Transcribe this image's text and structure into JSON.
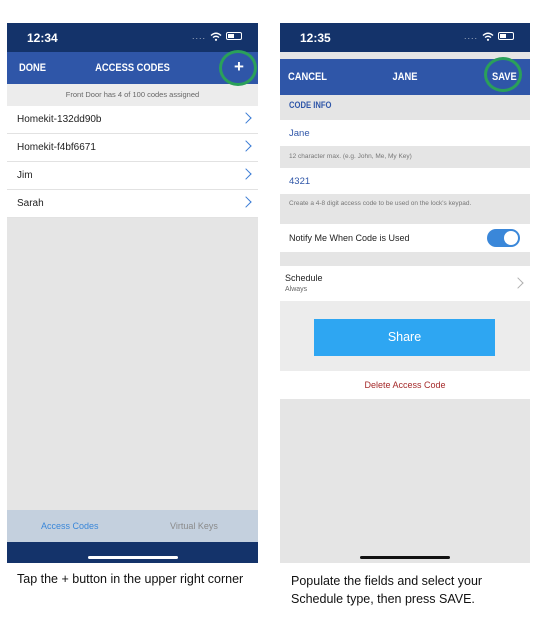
{
  "phone1": {
    "status": {
      "time": "12:34",
      "dots": "...."
    },
    "nav": {
      "left": "DONE",
      "title": "ACCESS CODES",
      "add_icon": "+"
    },
    "banner": "Front Door has 4 of 100 codes assigned",
    "codes": [
      "Homekit-132dd90b",
      "Homekit-f4bf6671",
      "Jim",
      "Sarah"
    ],
    "tabs": {
      "active": "Access Codes",
      "inactive": "Virtual Keys"
    }
  },
  "phone2": {
    "status": {
      "time": "12:35",
      "dots": "...."
    },
    "nav": {
      "left": "CANCEL",
      "title": "JANE",
      "right": "SAVE"
    },
    "section": "CODE INFO",
    "name_value": "Jane",
    "name_hint": "12 character max. (e.g. John, Me, My Key)",
    "code_value": "4321",
    "code_hint": "Create a 4-8 digit access code to be used on the lock's keypad.",
    "notify_label": "Notify Me When Code is Used",
    "notify_on": true,
    "schedule_label": "Schedule",
    "schedule_value": "Always",
    "share_label": "Share",
    "delete_label": "Delete Access Code"
  },
  "captions": {
    "left": "Tap the + button in the upper right corner",
    "right": "Populate the fields and select your Schedule type, then press SAVE."
  },
  "colors": {
    "status_bar": "#14336a",
    "nav_bar": "#2f56a8",
    "highlight_ring": "#2aa05a",
    "share_button": "#2ea6f2",
    "delete_text": "#a52a2a",
    "toggle_on": "#3a87d9"
  }
}
